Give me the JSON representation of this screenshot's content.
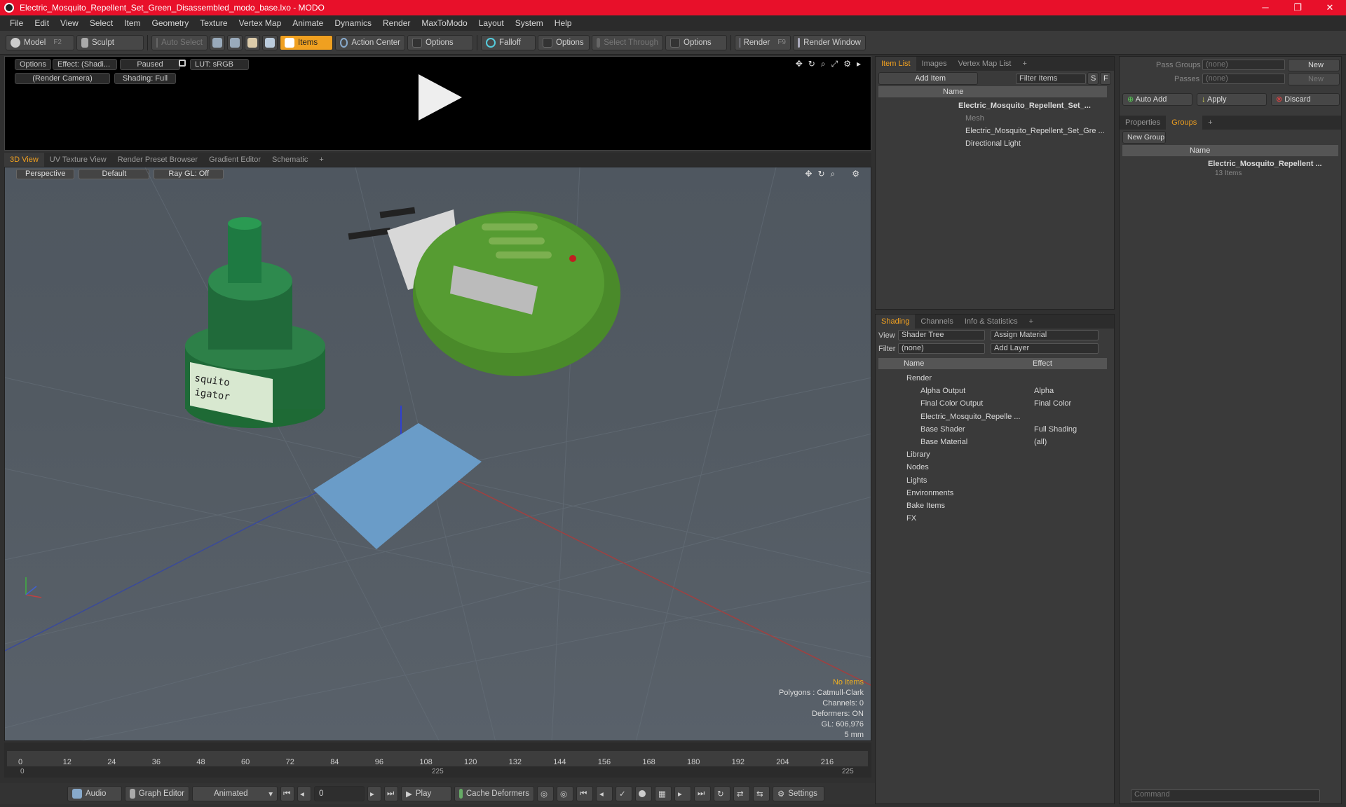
{
  "window": {
    "title": "Electric_Mosquito_Repellent_Set_Green_Disassembled_modo_base.lxo - MODO",
    "minimize": "─",
    "maximize": "❐",
    "close": "✕"
  },
  "menu": [
    "File",
    "Edit",
    "View",
    "Select",
    "Item",
    "Geometry",
    "Texture",
    "Vertex Map",
    "Animate",
    "Dynamics",
    "Render",
    "MaxToModo",
    "Layout",
    "System",
    "Help"
  ],
  "toolbar": {
    "model": "Model",
    "model_key": "F2",
    "sculpt": "Sculpt",
    "auto_select": "Auto Select",
    "items": "Items",
    "action_center": "Action Center",
    "options1": "Options",
    "falloff": "Falloff",
    "options2": "Options",
    "select_through": "Select Through",
    "options3": "Options",
    "render": "Render",
    "render_key": "F9",
    "render_window": "Render Window"
  },
  "preview": {
    "options": "Options",
    "effect": "Effect: (Shadi...",
    "paused": "Paused",
    "lut": "LUT: sRGB",
    "camera": "(Render Camera)",
    "shading": "Shading: Full"
  },
  "viewport_tabs": [
    "3D View",
    "UV Texture View",
    "Render Preset Browser",
    "Gradient Editor",
    "Schematic",
    "+"
  ],
  "viewport": {
    "perspective": "Perspective",
    "default": "Default",
    "raygl": "Ray GL: Off",
    "label_line1": "squito",
    "label_line2": "igator",
    "stats": {
      "no_items": "No Items",
      "polygons": "Polygons : Catmull-Clark",
      "channels": "Channels: 0",
      "deformers": "Deformers: ON",
      "gl": "GL: 606,976",
      "scale": "5 mm"
    }
  },
  "timeline": {
    "ticks": [
      "0",
      "12",
      "24",
      "36",
      "48",
      "60",
      "72",
      "84",
      "96",
      "108",
      "120",
      "132",
      "144",
      "156",
      "168",
      "180",
      "192",
      "204",
      "216"
    ],
    "start": "0",
    "mid": "225",
    "end": "225"
  },
  "bottombar": {
    "audio": "Audio",
    "graph_editor": "Graph Editor",
    "animated": "Animated",
    "frame": "0",
    "play": "Play",
    "cache": "Cache Deformers",
    "settings": "Settings"
  },
  "itemlist": {
    "tabs": [
      "Item List",
      "Images",
      "Vertex Map List",
      "+"
    ],
    "add_item": "Add Item",
    "filter_items": "Filter Items",
    "s": "S",
    "f": "F",
    "col_name": "Name",
    "rows": [
      "Electric_Mosquito_Repellent_Set_...",
      "Mesh",
      "Electric_Mosquito_Repellent_Set_Gre ...",
      "Directional Light"
    ]
  },
  "shading": {
    "tabs": [
      "Shading",
      "Channels",
      "Info & Statistics",
      "+"
    ],
    "view_label": "View",
    "view_value": "Shader Tree",
    "assign_material": "Assign Material",
    "filter_label": "Filter",
    "filter_value": "(none)",
    "add_layer": "Add Layer",
    "col_name": "Name",
    "col_effect": "Effect",
    "rows": [
      {
        "name": "Render",
        "effect": ""
      },
      {
        "name": "Alpha Output",
        "effect": "Alpha"
      },
      {
        "name": "Final Color Output",
        "effect": "Final Color"
      },
      {
        "name": "Electric_Mosquito_Repelle ...",
        "effect": ""
      },
      {
        "name": "Base Shader",
        "effect": "Full Shading"
      },
      {
        "name": "Base Material",
        "effect": "(all)"
      },
      {
        "name": "Library",
        "effect": ""
      },
      {
        "name": "Nodes",
        "effect": ""
      },
      {
        "name": "Lights",
        "effect": ""
      },
      {
        "name": "Environments",
        "effect": ""
      },
      {
        "name": "Bake Items",
        "effect": ""
      },
      {
        "name": "FX",
        "effect": ""
      }
    ]
  },
  "groups": {
    "pass_groups": "Pass Groups",
    "pass_groups_value": "(none)",
    "new": "New",
    "passes": "Passes",
    "passes_value": "(none)",
    "new2": "New",
    "auto_add": "Auto Add",
    "apply": "Apply",
    "discard": "Discard",
    "tabs": [
      "Properties",
      "Groups",
      "+"
    ],
    "new_group": "New Group",
    "col_name": "Name",
    "group_name": "Electric_Mosquito_Repellent ...",
    "group_count": "13 Items"
  },
  "command": {
    "placeholder": "Command"
  }
}
